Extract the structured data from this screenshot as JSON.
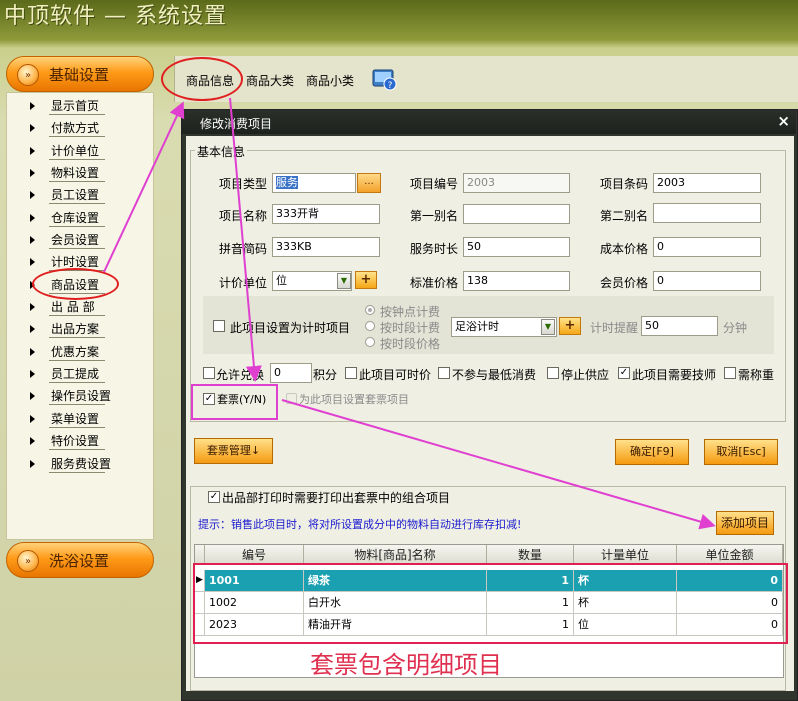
{
  "app": {
    "title": "中顶软件 — 系统设置"
  },
  "sidebar": {
    "basic_section": "基础设置",
    "bath_section": "洗浴设置",
    "items": [
      "显示首页",
      "付款方式",
      "计价单位",
      "物料设置",
      "员工设置",
      "仓库设置",
      "会员设置",
      "计时设置",
      "商品设置",
      "出 品 部",
      "出品方案",
      "优惠方案",
      "员工提成",
      "操作员设置",
      "菜单设置",
      "特价设置",
      "服务费设置"
    ]
  },
  "tabs": [
    "商品信息",
    "商品大类",
    "商品小类"
  ],
  "dialog": {
    "title": "修改消费项目",
    "close": "×",
    "basic_group": "基本信息",
    "fields": {
      "item_type_label": "项目类型",
      "item_type": "服务",
      "dots": "...",
      "item_code_label": "项目编号",
      "item_code": "2003",
      "barcode_label": "项目条码",
      "barcode": "2003",
      "item_name_label": "项目名称",
      "item_name": "333开背",
      "alias1_label": "第一别名",
      "alias1": "",
      "alias2_label": "第二别名",
      "alias2": "",
      "pinyin_label": "拼音简码",
      "pinyin": "333KB",
      "duration_label": "服务时长",
      "duration": "50",
      "cost_label": "成本价格",
      "cost": "0",
      "unit_label": "计价单位",
      "unit": "位",
      "std_price_label": "标准价格",
      "std_price": "138",
      "member_price_label": "会员价格",
      "member_price": "0"
    },
    "timing": {
      "checkbox_label": "此项目设置为计时项目",
      "radio1": "按钟点计费",
      "radio2": "按时段计费",
      "radio3": "按时段价格",
      "mode": "足浴计时",
      "plus": "+",
      "reminder_label": "计时提醒",
      "reminder": "50",
      "reminder_unit": "分钟"
    },
    "options": {
      "allow_exchange": "允许兑换",
      "points": "0",
      "points_unit": "积分",
      "timed_price": "此项目可时价",
      "no_min_spend": "不参与最低消费",
      "stop_supply": "停止供应",
      "need_tech": "此项目需要技师",
      "need_weigh": "需称重",
      "set_ticket": "套票(Y/N)",
      "set_ticket_check": "✓",
      "need_tech_check": "✓",
      "set_ticket_items": "为此项目设置套票项目"
    },
    "buttons": {
      "set_mgmt": "套票管理↓",
      "confirm": "确定[F9]",
      "cancel": "取消[Esc]"
    },
    "combo": {
      "group_label": "出品部打印时需要打印出套票中的组合项目",
      "hint": "提示：销售此项目时，将对所设置成分中的物料自动进行库存扣减!",
      "add_button": "添加项目",
      "columns": [
        "编号",
        "物料[商品]名称",
        "数量",
        "计量单位",
        "单位金额"
      ],
      "rows": [
        {
          "code": "1001",
          "name": "绿茶",
          "qty": "1",
          "unit": "杯",
          "amount": "0"
        },
        {
          "code": "1002",
          "name": "白开水",
          "qty": "1",
          "unit": "杯",
          "amount": "0"
        },
        {
          "code": "2023",
          "name": "精油开背",
          "qty": "1",
          "unit": "位",
          "amount": "0"
        }
      ]
    }
  },
  "annotation": {
    "text": "套票包含明细项目"
  },
  "colors": {
    "accent_orange": "#f59a10",
    "selected_row": "#1aa0b0",
    "annotation_red": "#e02020",
    "annotation_magenta": "#e040d0"
  }
}
